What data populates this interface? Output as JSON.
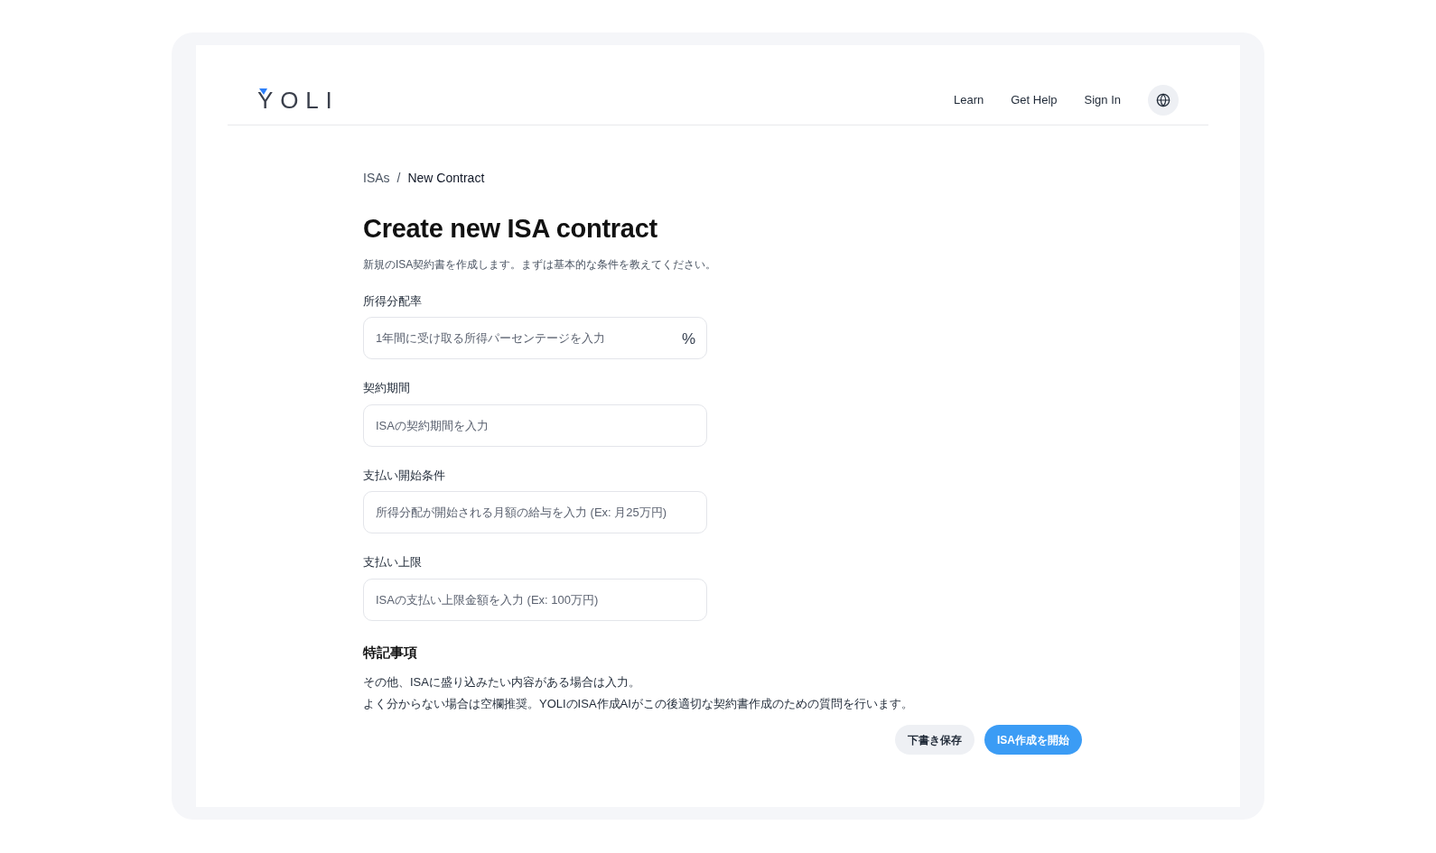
{
  "header": {
    "logo": "YOLI",
    "nav": [
      {
        "label": "Learn"
      },
      {
        "label": "Get Help"
      },
      {
        "label": "Sign In"
      }
    ]
  },
  "breadcrumb": [
    {
      "label": "ISAs"
    },
    {
      "label": "New Contract"
    }
  ],
  "breadcrumb_separator": "/",
  "title": "Create new ISA contract",
  "subtitle": "新規のISA契約書を作成します。まずは基本的な条件を教えてください。",
  "fields": [
    {
      "label": "所得分配率",
      "placeholder": "1年間に受け取る所得パーセンテージを入力",
      "suffix": "%"
    },
    {
      "label": "契約期間",
      "placeholder": "ISAの契約期間を入力"
    },
    {
      "label": "支払い開始条件",
      "placeholder": "所得分配が開始される月額の給与を入力 (Ex: 月25万円)"
    },
    {
      "label": "支払い上限",
      "placeholder": "ISAの支払い上限金額を入力 (Ex: 100万円)"
    }
  ],
  "notes": {
    "heading": "特記事項",
    "lines": [
      "その他、ISAに盛り込みたい内容がある場合は入力。",
      "よく分からない場合は空欄推奨。YOLIのISA作成AIがこの後適切な契約書作成のための質問を行います。"
    ]
  },
  "buttons": [
    {
      "label": "下書き保存",
      "kind": "secondary"
    },
    {
      "label": "ISA作成を開始",
      "kind": "primary"
    }
  ]
}
